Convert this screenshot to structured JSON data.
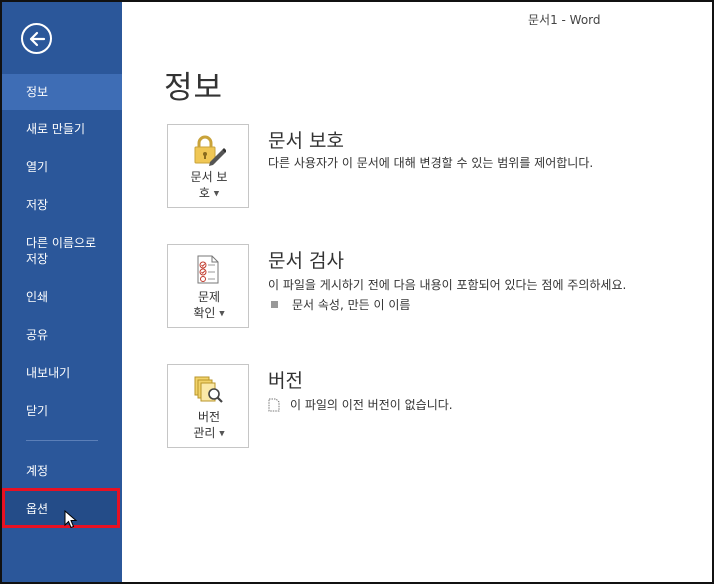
{
  "window": {
    "title": "문서1 - Word"
  },
  "sidebar": {
    "items": [
      {
        "label": "정보"
      },
      {
        "label": "새로 만들기"
      },
      {
        "label": "열기"
      },
      {
        "label": "저장"
      },
      {
        "label": "다른 이름으로 저장",
        "line1": "다른 이름으로",
        "line2": "저장"
      },
      {
        "label": "인쇄"
      },
      {
        "label": "공유"
      },
      {
        "label": "내보내기"
      },
      {
        "label": "닫기"
      },
      {
        "label": "계정"
      },
      {
        "label": "옵션"
      }
    ],
    "active_item": "정보",
    "highlighted_item": "옵션"
  },
  "main": {
    "page_title": "정보",
    "sections": [
      {
        "button_line1": "문서 보",
        "button_line2": "호",
        "icon": "lock-pen-icon",
        "heading": "문서 보호",
        "description": "다른 사용자가 이 문서에 대해 변경할 수 있는 범위를 제어합니다."
      },
      {
        "button_line1": "문제",
        "button_line2": "확인",
        "icon": "inspect-document-icon",
        "heading": "문서 검사",
        "description": "이 파일을 게시하기 전에 다음 내용이 포함되어 있다는 점에 주의하세요.",
        "items": [
          "문서 속성, 만든 이 이름"
        ]
      },
      {
        "button_line1": "버전",
        "button_line2": "관리",
        "icon": "manage-versions-icon",
        "heading": "버전",
        "items": [
          "이 파일의 이전 버전이 없습니다."
        ]
      }
    ]
  },
  "colors": {
    "sidebar_bg": "#2b579a",
    "sidebar_active": "#3e6db5",
    "highlight_border": "#e81123"
  }
}
